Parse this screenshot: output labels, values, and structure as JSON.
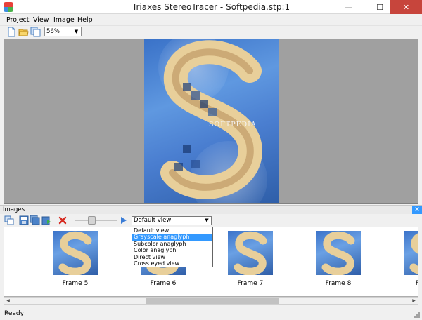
{
  "window": {
    "title": "Triaxes StereoTracer - Softpedia.stp:1"
  },
  "menu": {
    "items": [
      {
        "label": "Project",
        "accesskey": "P"
      },
      {
        "label": "View",
        "accesskey": "V"
      },
      {
        "label": "Image",
        "accesskey": "I"
      },
      {
        "label": "Help",
        "accesskey": "H"
      }
    ]
  },
  "toolbar": {
    "zoom_value": "56%"
  },
  "viewer": {
    "image_caption": "SOFTPEDIA"
  },
  "images_panel": {
    "title": "Images",
    "view_select_value": "Default view",
    "view_options": [
      "Default view",
      "Grayscale anaglyph",
      "Subcolor anaglyph",
      "Color anaglyph",
      "Direct view",
      "Cross eyed view"
    ],
    "selected_option": "Grayscale anaglyph",
    "frames": [
      "Frame 5",
      "Frame 6",
      "Frame 7",
      "Frame 8",
      "F"
    ]
  },
  "status": {
    "text": "Ready"
  },
  "colors": {
    "accent": "#3399ff",
    "close_button": "#c7453c",
    "viewer_bg": "#a0a0a0"
  },
  "icons": [
    "app-logo",
    "new-project",
    "open-folder",
    "save-copy",
    "copy-frames",
    "save",
    "save-all",
    "export",
    "delete",
    "play"
  ]
}
